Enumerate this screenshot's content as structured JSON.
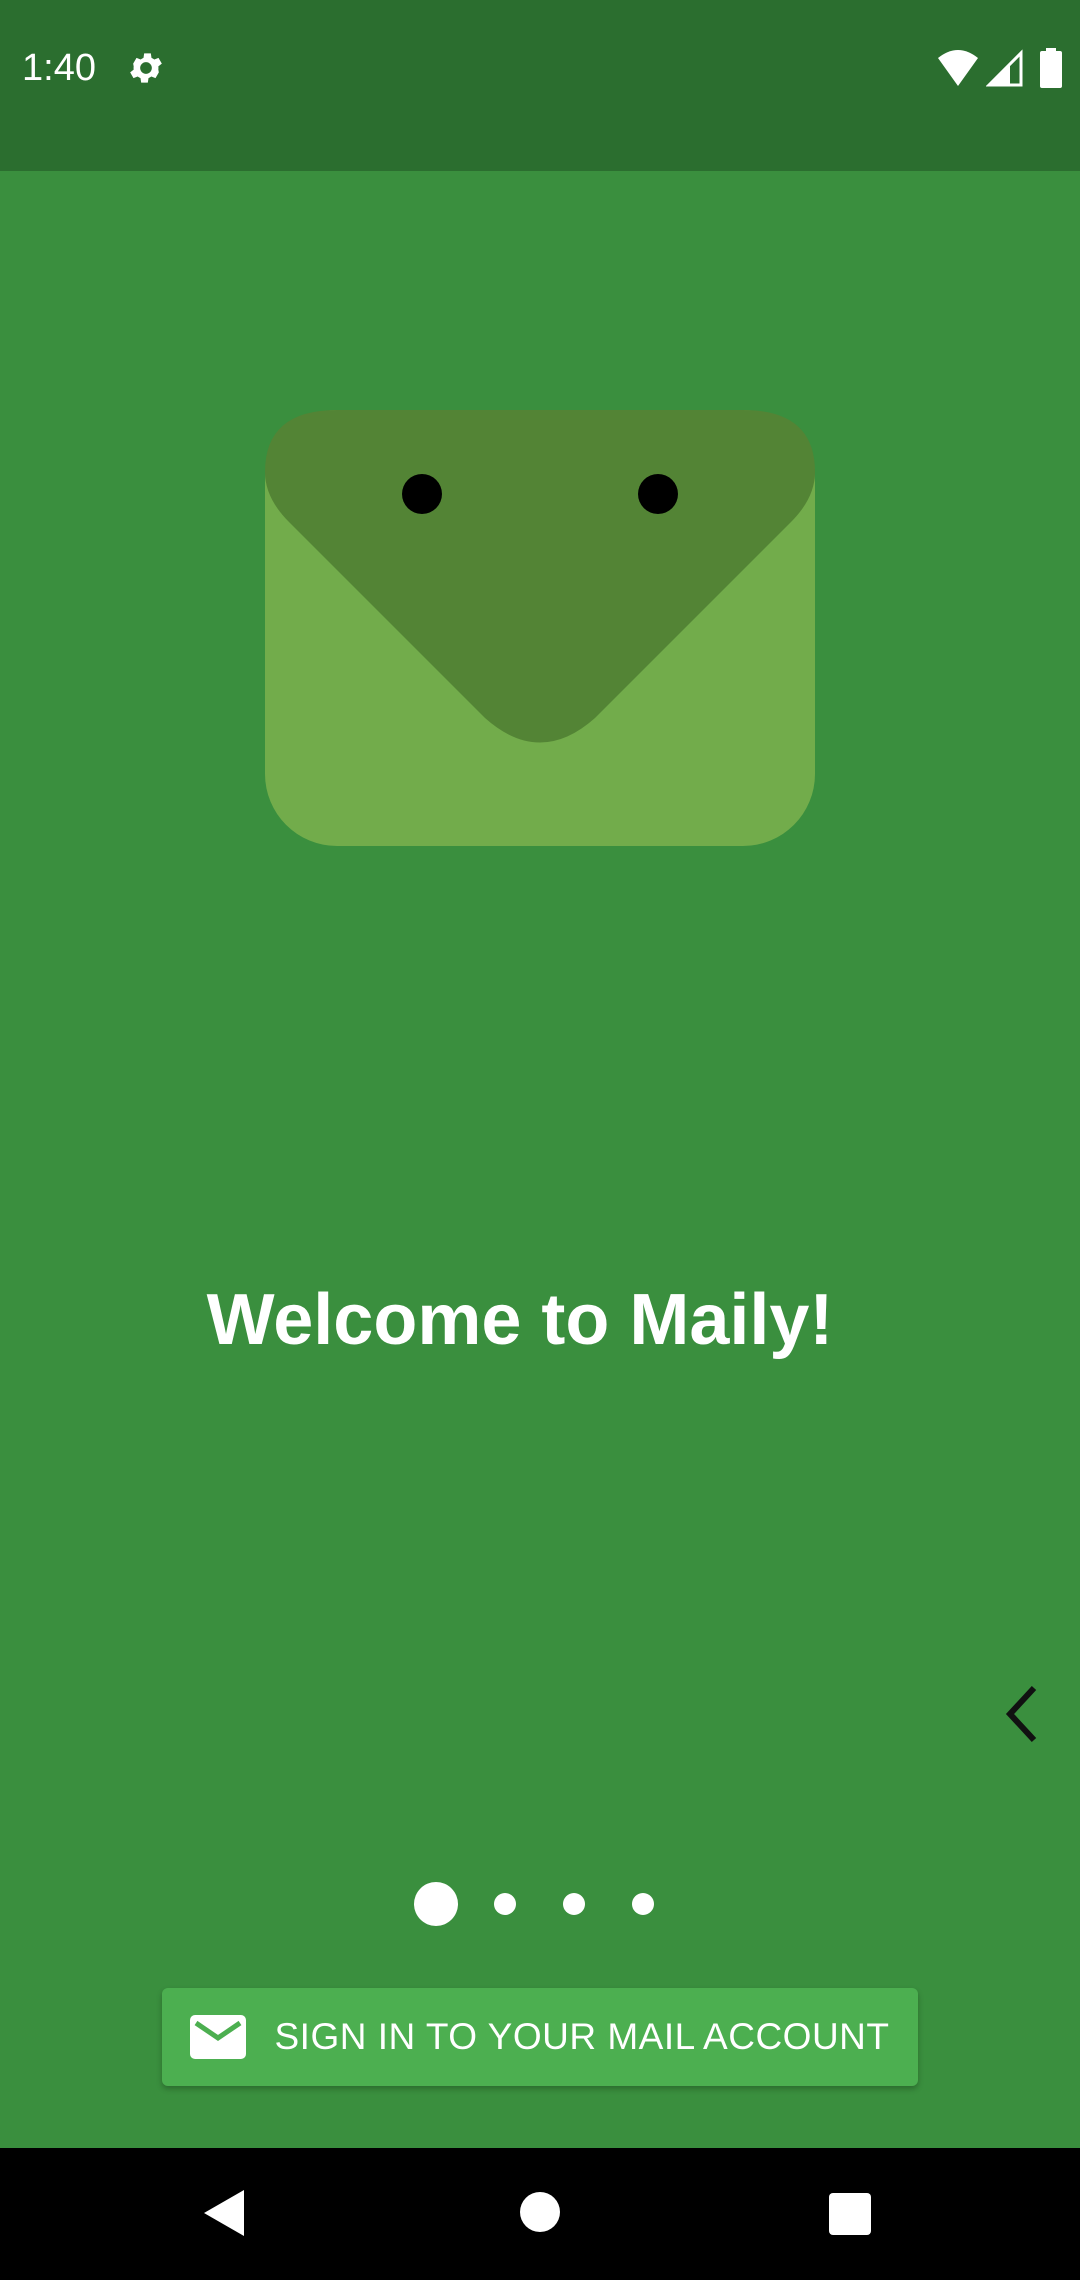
{
  "status_bar": {
    "time": "1:40",
    "icons": [
      "gear-icon",
      "wifi-icon",
      "cell-signal-icon",
      "battery-icon"
    ],
    "background": "#2b6e2f"
  },
  "onboarding": {
    "title": "Welcome to Maily!",
    "page_indicator": {
      "total": 4,
      "current": 1
    },
    "sign_in_label": "SIGN IN TO YOUR MAIL ACCOUNT",
    "sign_in_icon": "mail-icon",
    "back_icon": "chevron-left-icon"
  },
  "colors": {
    "background": "#3a8f3e",
    "button": "#4caf50",
    "mascot_body": "#72ac4b",
    "mascot_flap": "#538435"
  },
  "nav_bar": {
    "icons": [
      "back-triangle-icon",
      "home-circle-icon",
      "recents-square-icon"
    ]
  }
}
